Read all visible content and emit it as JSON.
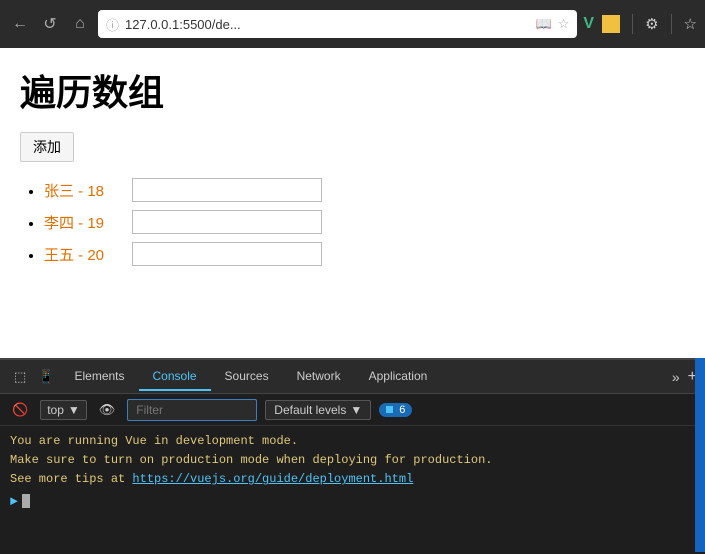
{
  "browser": {
    "url": "127.0.0.1:5500/de...",
    "back_label": "←",
    "refresh_label": "↺",
    "home_label": "⌂",
    "info_label": "ⓘ"
  },
  "page": {
    "title": "遍历数组",
    "add_button_label": "添加",
    "items": [
      {
        "label": "张三 - 18",
        "input_value": ""
      },
      {
        "label": "李四 - 19",
        "input_value": ""
      },
      {
        "label": "王五 - 20",
        "input_value": ""
      }
    ]
  },
  "devtools": {
    "tabs": [
      "Elements",
      "Console",
      "Sources",
      "Network",
      "Application"
    ],
    "active_tab": "Console",
    "toolbar": {
      "top_label": "top",
      "filter_placeholder": "Filter",
      "levels_label": "Default levels",
      "badge_count": "6"
    },
    "console_messages": [
      "You are running Vue in development mode.",
      "Make sure to turn on production mode when deploying for production.",
      "See more tips at "
    ],
    "console_link": "https://vuejs.org/guide/deployment.html"
  }
}
